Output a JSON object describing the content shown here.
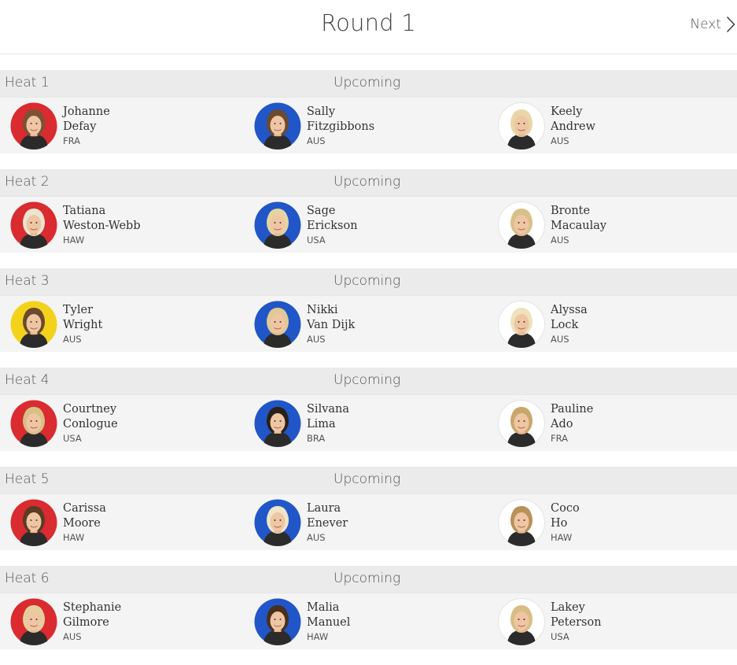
{
  "header": {
    "title": "Round 1",
    "next_label": "Next"
  },
  "colors": {
    "red": "#d92b30",
    "blue": "#2056c7",
    "yellow": "#f3d21c",
    "white": "#ffffff"
  },
  "heats": [
    {
      "name": "Heat 1",
      "status": "Upcoming",
      "athletes": [
        {
          "first": "Johanne",
          "last": "Defay",
          "country": "FRA",
          "jersey": "red",
          "hair": "#7a5234"
        },
        {
          "first": "Sally",
          "last": "Fitzgibbons",
          "country": "AUS",
          "jersey": "blue",
          "hair": "#6b4a2e"
        },
        {
          "first": "Keely",
          "last": "Andrew",
          "country": "AUS",
          "jersey": "white",
          "hair": "#e8d6a6"
        }
      ]
    },
    {
      "name": "Heat 2",
      "status": "Upcoming",
      "athletes": [
        {
          "first": "Tatiana",
          "last": "Weston-Webb",
          "country": "HAW",
          "jersey": "red",
          "hair": "#ede4d0"
        },
        {
          "first": "Sage",
          "last": "Erickson",
          "country": "USA",
          "jersey": "blue",
          "hair": "#e6d3a2"
        },
        {
          "first": "Bronte",
          "last": "Macaulay",
          "country": "AUS",
          "jersey": "white",
          "hair": "#d8c089"
        }
      ]
    },
    {
      "name": "Heat 3",
      "status": "Upcoming",
      "athletes": [
        {
          "first": "Tyler",
          "last": "Wright",
          "country": "AUS",
          "jersey": "yellow",
          "hair": "#6b4a2e"
        },
        {
          "first": "Nikki",
          "last": "Van Dijk",
          "country": "AUS",
          "jersey": "blue",
          "hair": "#e0c994"
        },
        {
          "first": "Alyssa",
          "last": "Lock",
          "country": "AUS",
          "jersey": "white",
          "hair": "#efe2bb"
        }
      ]
    },
    {
      "name": "Heat 4",
      "status": "Upcoming",
      "athletes": [
        {
          "first": "Courtney",
          "last": "Conlogue",
          "country": "USA",
          "jersey": "red",
          "hair": "#d7bf86"
        },
        {
          "first": "Silvana",
          "last": "Lima",
          "country": "BRA",
          "jersey": "blue",
          "hair": "#2a2018"
        },
        {
          "first": "Pauline",
          "last": "Ado",
          "country": "FRA",
          "jersey": "white",
          "hair": "#c9a66a"
        }
      ]
    },
    {
      "name": "Heat 5",
      "status": "Upcoming",
      "athletes": [
        {
          "first": "Carissa",
          "last": "Moore",
          "country": "HAW",
          "jersey": "red",
          "hair": "#5a3c24"
        },
        {
          "first": "Laura",
          "last": "Enever",
          "country": "AUS",
          "jersey": "blue",
          "hair": "#efe5c8"
        },
        {
          "first": "Coco",
          "last": "Ho",
          "country": "HAW",
          "jersey": "white",
          "hair": "#b89058"
        }
      ]
    },
    {
      "name": "Heat 6",
      "status": "Upcoming",
      "athletes": [
        {
          "first": "Stephanie",
          "last": "Gilmore",
          "country": "AUS",
          "jersey": "red",
          "hair": "#e3cf9c"
        },
        {
          "first": "Malia",
          "last": "Manuel",
          "country": "HAW",
          "jersey": "blue",
          "hair": "#4a2f1c"
        },
        {
          "first": "Lakey",
          "last": "Peterson",
          "country": "USA",
          "jersey": "white",
          "hair": "#d9bd83"
        }
      ]
    }
  ]
}
